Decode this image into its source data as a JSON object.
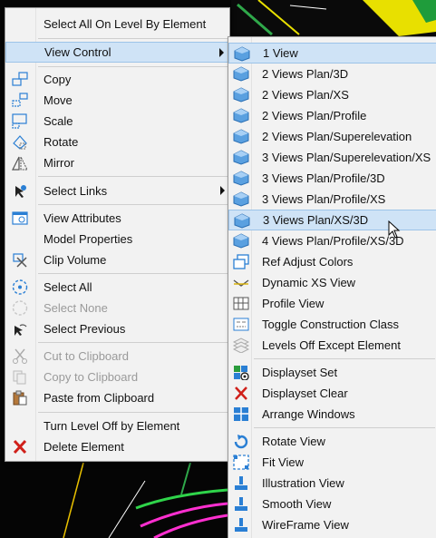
{
  "main_menu": {
    "items": [
      {
        "label": "Select All On Level By Element",
        "icon": "none"
      },
      {
        "label": "View Control",
        "icon": "none",
        "submenu": true,
        "highlighted": true
      },
      {
        "label": "Copy",
        "icon": "copy-icon"
      },
      {
        "label": "Move",
        "icon": "move-icon"
      },
      {
        "label": "Scale",
        "icon": "scale-icon"
      },
      {
        "label": "Rotate",
        "icon": "rotate-icon"
      },
      {
        "label": "Mirror",
        "icon": "mirror-icon"
      },
      {
        "label": "Select Links",
        "icon": "select-links-icon",
        "submenu": true
      },
      {
        "label": "View Attributes",
        "icon": "view-attributes-icon"
      },
      {
        "label": "Model Properties",
        "icon": "none"
      },
      {
        "label": "Clip Volume",
        "icon": "clip-volume-icon"
      },
      {
        "label": "Select All",
        "icon": "select-all-icon"
      },
      {
        "label": "Select None",
        "icon": "select-none-icon",
        "disabled": true
      },
      {
        "label": "Select Previous",
        "icon": "select-previous-icon"
      },
      {
        "label": "Cut to Clipboard",
        "icon": "scissors-icon",
        "disabled": true
      },
      {
        "label": "Copy to Clipboard",
        "icon": "copy-clipboard-icon",
        "disabled": true
      },
      {
        "label": "Paste from Clipboard",
        "icon": "paste-icon"
      },
      {
        "label": "Turn Level Off by Element",
        "icon": "none"
      },
      {
        "label": "Delete Element",
        "icon": "delete-x-icon"
      }
    ]
  },
  "sub_menu": {
    "items": [
      {
        "label": "1 View",
        "icon": "view-cube-icon",
        "highlighted": true
      },
      {
        "label": "2 Views Plan/3D",
        "icon": "view-cube-icon"
      },
      {
        "label": "2 Views Plan/XS",
        "icon": "view-cube-icon"
      },
      {
        "label": "2 Views Plan/Profile",
        "icon": "view-cube-icon"
      },
      {
        "label": "2 Views Plan/Superelevation",
        "icon": "view-cube-icon"
      },
      {
        "label": "3 Views Plan/Superelevation/XS",
        "icon": "view-cube-icon"
      },
      {
        "label": "3 Views Plan/Profile/3D",
        "icon": "view-cube-icon"
      },
      {
        "label": "3 Views Plan/Profile/XS",
        "icon": "view-cube-icon"
      },
      {
        "label": "3 Views Plan/XS/3D",
        "icon": "view-cube-icon",
        "highlighted": true
      },
      {
        "label": "4 Views Plan/Profile/XS/3D",
        "icon": "view-cube-icon"
      },
      {
        "label": "Ref Adjust Colors",
        "icon": "ref-adjust-colors-icon"
      },
      {
        "label": "Dynamic XS View",
        "icon": "dynamic-xs-icon"
      },
      {
        "label": "Profile View",
        "icon": "profile-grid-icon"
      },
      {
        "label": "Toggle Construction Class",
        "icon": "construction-class-icon"
      },
      {
        "label": "Levels Off Except Element",
        "icon": "levels-off-icon"
      },
      {
        "label": "Displayset Set",
        "icon": "displayset-set-icon"
      },
      {
        "label": "Displayset Clear",
        "icon": "displayset-clear-icon"
      },
      {
        "label": "Arrange Windows",
        "icon": "arrange-windows-icon"
      },
      {
        "label": "Rotate View",
        "icon": "rotate-view-icon"
      },
      {
        "label": "Fit View",
        "icon": "fit-view-icon"
      },
      {
        "label": "Illustration View",
        "icon": "render-brush-icon"
      },
      {
        "label": "Smooth View",
        "icon": "render-brush-icon"
      },
      {
        "label": "WireFrame View",
        "icon": "render-brush-icon"
      }
    ]
  },
  "colors": {
    "highlight_bg": "#cfe3f6",
    "highlight_border": "#9cc3e8",
    "menu_bg": "#f2f2f2",
    "disabled_text": "#9a9a9a",
    "icon_blue": "#2a7fd4",
    "delete_red": "#d0201a"
  }
}
